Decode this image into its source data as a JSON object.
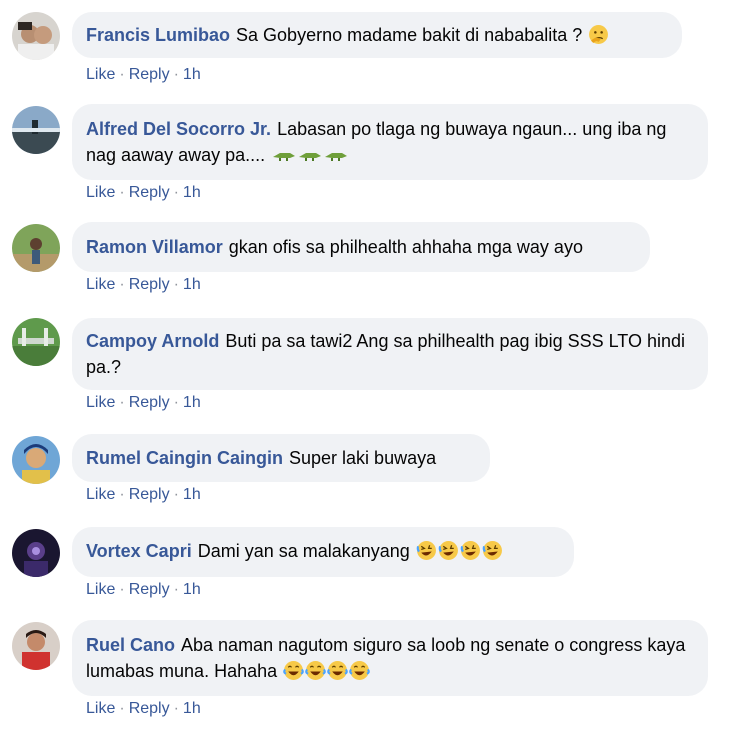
{
  "comments": [
    {
      "author": "Francis Lumibao",
      "text": "Sa Gobyerno madame bakit di nababalita ?",
      "emoji": "thinking-face",
      "like": "Like",
      "reply": "Reply",
      "dot": "·",
      "time": "1h"
    },
    {
      "author": "Alfred Del Socorro Jr.",
      "text": "Labasan po tlaga ng buwaya ngaun... ung iba ng nag aaway away pa....",
      "emoji": "crocodile x3",
      "like": "Like",
      "reply": "Reply",
      "dot": "·",
      "time": "1h"
    },
    {
      "author": "Ramon Villamor",
      "text": "gkan ofis sa philhealth ahhaha mga way ayo",
      "like": "Like",
      "reply": "Reply",
      "dot": "·",
      "time": "1h"
    },
    {
      "author": "Campoy Arnold",
      "text": "Buti pa sa tawi2 Ang sa philhealth pag ibig SSS LTO hindi pa.?",
      "like": "Like",
      "reply": "Reply",
      "dot": "·",
      "time": "1h"
    },
    {
      "author": "Rumel Caingin Caingin",
      "text": "Super laki buwaya",
      "like": "Like",
      "reply": "Reply",
      "dot": "·",
      "time": "1h"
    },
    {
      "author": "Vortex Capri",
      "text": "Dami yan sa malakanyang",
      "emoji": "rolling-on-floor-laughing x4",
      "like": "Like",
      "reply": "Reply",
      "dot": "·",
      "time": "1h"
    },
    {
      "author": "Ruel Cano",
      "text": "Aba naman nagutom siguro sa loob ng senate o congress kaya lumabas muna. Hahaha",
      "emoji": "tears-of-joy x4",
      "like": "Like",
      "reply": "Reply",
      "dot": "·",
      "time": "1h"
    }
  ],
  "colors": {
    "author": "#385898",
    "bubble": "#f0f2f5",
    "text": "#050505",
    "action": "#385898"
  }
}
